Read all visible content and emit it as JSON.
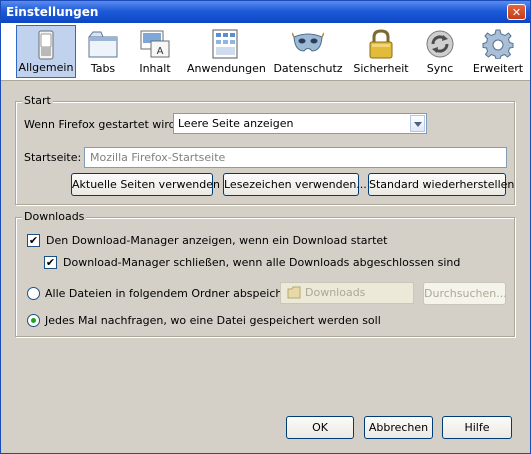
{
  "window": {
    "title": "Einstellungen",
    "close_symbol": "✕"
  },
  "toolbar": {
    "panes": [
      {
        "label": "Allgemein",
        "icon": "switch-icon",
        "selected": true
      },
      {
        "label": "Tabs",
        "icon": "tabs-icon",
        "selected": false
      },
      {
        "label": "Inhalt",
        "icon": "content-icon",
        "selected": false
      },
      {
        "label": "Anwendungen",
        "icon": "applications-icon",
        "selected": false
      },
      {
        "label": "Datenschutz",
        "icon": "privacy-mask-icon",
        "selected": false
      },
      {
        "label": "Sicherheit",
        "icon": "padlock-icon",
        "selected": false
      },
      {
        "label": "Sync",
        "icon": "sync-icon",
        "selected": false
      },
      {
        "label": "Erweitert",
        "icon": "gear-icon",
        "selected": false
      }
    ]
  },
  "start": {
    "legend": "Start",
    "startup_label": "Wenn Firefox gestartet wird:",
    "startup_value": "Leere Seite anzeigen",
    "homepage_label": "Startseite:",
    "homepage_placeholder": "Mozilla Firefox-Startseite",
    "use_current_button": "Aktuelle Seiten verwenden",
    "use_bookmark_button": "Lesezeichen verwenden...",
    "restore_default_button": "Standard wiederherstellen"
  },
  "downloads": {
    "legend": "Downloads",
    "show_manager_label": "Den Download-Manager anzeigen, wenn ein Download startet",
    "show_manager_checked": true,
    "close_manager_label": "Download-Manager schließen, wenn alle Downloads abgeschlossen sind",
    "close_manager_checked": true,
    "save_to_label": "Alle Dateien in folgendem Ordner abspeichern:",
    "folder_value": "Downloads",
    "browse_button": "Durchsuchen...",
    "always_ask_label": "Jedes Mal nachfragen, wo eine Datei gespeichert werden soll",
    "selected_option": "always_ask"
  },
  "footer": {
    "ok_button": "OK",
    "cancel_button": "Abbrechen",
    "help_button": "Hilfe"
  },
  "colors": {
    "titlebar": "#0c46c4",
    "selected_pane": "#c1d2ee",
    "dialog_bg": "#d4d0c8"
  }
}
